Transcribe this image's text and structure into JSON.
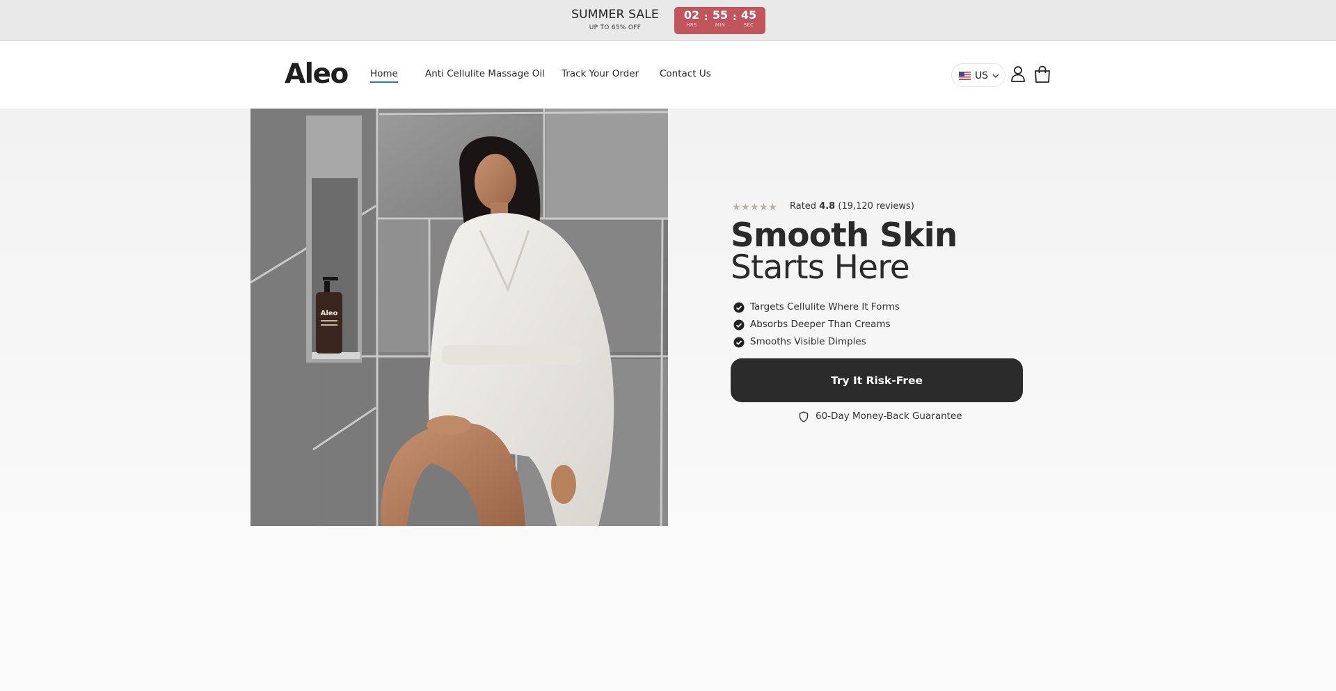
{
  "announcement": {
    "title": "SUMMER SALE",
    "subtitle": "UP TO 65% OFF",
    "countdown": {
      "hours": "02",
      "hours_label": "HRS",
      "minutes": "55",
      "minutes_label": "MIN",
      "seconds": "45",
      "seconds_label": "SEC",
      "separator": ":"
    },
    "countdown_color": "#c0555d"
  },
  "header": {
    "logo": "Aleo",
    "nav": [
      {
        "label": "Home",
        "active": true
      },
      {
        "label": "Anti Cellulite Massage Oil"
      },
      {
        "label": "Track Your Order"
      },
      {
        "label": "Contact Us"
      }
    ],
    "locale": {
      "flag_icon": "us-flag-icon",
      "label": "US"
    },
    "icons": {
      "account": "user-icon",
      "cart": "shopping-bag-icon"
    },
    "accent_color": "#23848b"
  },
  "hero": {
    "image": {
      "bottle_brand": "Aleo",
      "bottle_label": "Anti-Cellulite Massage Oil"
    },
    "rating": {
      "stars": "★★★★★",
      "prefix": "Rated",
      "value": "4.8",
      "reviews": "(19,120 reviews)"
    },
    "headline_bold": "Smooth Skin",
    "headline_light": "Starts Here",
    "benefits": [
      "Targets Cellulite Where It Forms",
      "Absorbs Deeper Than Creams",
      "Smooths Visible Dimples"
    ],
    "cta_label": "Try It Risk-Free",
    "guarantee": "60-Day Money-Back Guarantee",
    "cta_color": "#2b2b2b"
  }
}
